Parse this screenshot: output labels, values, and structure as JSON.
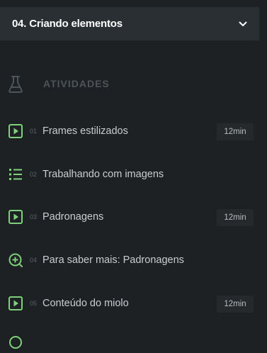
{
  "section": {
    "title": "04. Criando elementos",
    "toggle_icon": "chevron-down-icon"
  },
  "activities_header": {
    "title": "ATIVIDADES",
    "icon": "flask-icon"
  },
  "colors": {
    "accent": "#7ed07a",
    "background": "#1d2124",
    "header_bg": "#2a2f33",
    "badge_bg": "#25292c"
  },
  "activities": [
    {
      "number": "01",
      "label": "Frames estilizados",
      "duration": "12min",
      "icon": "video-play-icon"
    },
    {
      "number": "02",
      "label": "Trabalhando com imagens",
      "duration": "",
      "icon": "list-icon"
    },
    {
      "number": "03",
      "label": "Padronagens",
      "duration": "12min",
      "icon": "video-play-icon"
    },
    {
      "number": "04",
      "label": "Para saber mais: Padronagens",
      "duration": "",
      "icon": "plus-circle-icon"
    },
    {
      "number": "05",
      "label": "Conteúdo do miolo",
      "duration": "12min",
      "icon": "video-play-icon"
    }
  ]
}
